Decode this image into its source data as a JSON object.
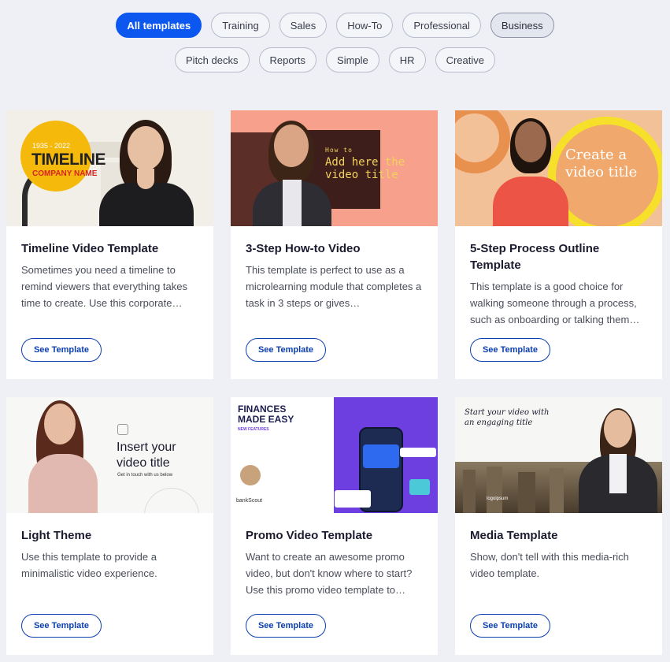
{
  "filters": {
    "row1": [
      "All templates",
      "Training",
      "Sales",
      "How-To",
      "Professional",
      "Business"
    ],
    "row2": [
      "Pitch decks",
      "Reports",
      "Simple",
      "HR",
      "Creative"
    ]
  },
  "cards": [
    {
      "title": "Timeline Video Template",
      "description": "Sometimes you need a timeline to remind viewers that everything takes time to create. Use this corporate…",
      "button": "See Template",
      "thumb": {
        "years": "1935 - 2022",
        "heading": "TIMELINE",
        "sub": "COMPANY NAME"
      }
    },
    {
      "title": "3-Step How-to Video",
      "description": "This template is perfect to use as a microlearning module that completes a task in 3 steps or gives…",
      "button": "See Template",
      "thumb": {
        "kicker": "How to",
        "heading": "Add here the video title"
      }
    },
    {
      "title": "5-Step Process Outline Template",
      "description": "This template is a good choice for walking someone through a process, such as onboarding or talking them…",
      "button": "See Template",
      "thumb": {
        "heading": "Create a video title"
      }
    },
    {
      "title": "Light Theme",
      "description": "Use this template to provide a minimalistic video experience.",
      "button": "See Template",
      "thumb": {
        "heading": "Insert your video title",
        "sub": "Get in touch with us below"
      }
    },
    {
      "title": "Promo Video Template",
      "description": "Want to create an awesome promo video, but don't know where to start? Use this promo video template to…",
      "button": "See Template",
      "thumb": {
        "heading": "FINANCES MADE EASY",
        "sub": "NEW FEATURES",
        "brand": "bankScout"
      }
    },
    {
      "title": "Media Template",
      "description": "Show, don't tell with this media-rich video template.",
      "button": "See Template",
      "thumb": {
        "heading": "Start your video with an engaging title",
        "brand": "logoipsum"
      }
    }
  ],
  "colors": {
    "accent": "#0b57f0",
    "button_text": "#0b3fb0",
    "page_bg": "#eef0f6"
  }
}
